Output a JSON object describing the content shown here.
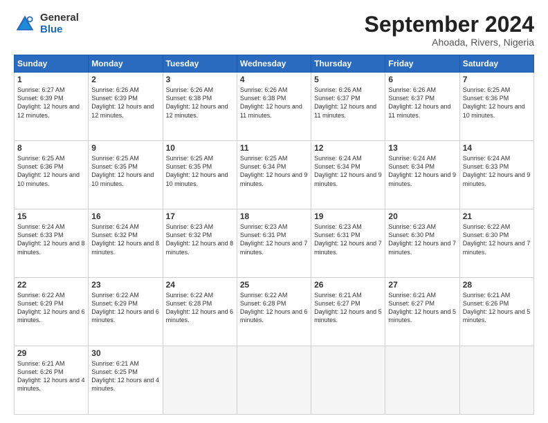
{
  "logo": {
    "general": "General",
    "blue": "Blue"
  },
  "title": "September 2024",
  "location": "Ahoada, Rivers, Nigeria",
  "days_of_week": [
    "Sunday",
    "Monday",
    "Tuesday",
    "Wednesday",
    "Thursday",
    "Friday",
    "Saturday"
  ],
  "weeks": [
    [
      {
        "day": "1",
        "info": "Sunrise: 6:27 AM\nSunset: 6:39 PM\nDaylight: 12 hours\nand 12 minutes."
      },
      {
        "day": "2",
        "info": "Sunrise: 6:26 AM\nSunset: 6:39 PM\nDaylight: 12 hours\nand 12 minutes."
      },
      {
        "day": "3",
        "info": "Sunrise: 6:26 AM\nSunset: 6:38 PM\nDaylight: 12 hours\nand 12 minutes."
      },
      {
        "day": "4",
        "info": "Sunrise: 6:26 AM\nSunset: 6:38 PM\nDaylight: 12 hours\nand 11 minutes."
      },
      {
        "day": "5",
        "info": "Sunrise: 6:26 AM\nSunset: 6:37 PM\nDaylight: 12 hours\nand 11 minutes."
      },
      {
        "day": "6",
        "info": "Sunrise: 6:26 AM\nSunset: 6:37 PM\nDaylight: 12 hours\nand 11 minutes."
      },
      {
        "day": "7",
        "info": "Sunrise: 6:25 AM\nSunset: 6:36 PM\nDaylight: 12 hours\nand 10 minutes."
      }
    ],
    [
      {
        "day": "8",
        "info": "Sunrise: 6:25 AM\nSunset: 6:36 PM\nDaylight: 12 hours\nand 10 minutes."
      },
      {
        "day": "9",
        "info": "Sunrise: 6:25 AM\nSunset: 6:35 PM\nDaylight: 12 hours\nand 10 minutes."
      },
      {
        "day": "10",
        "info": "Sunrise: 6:25 AM\nSunset: 6:35 PM\nDaylight: 12 hours\nand 10 minutes."
      },
      {
        "day": "11",
        "info": "Sunrise: 6:25 AM\nSunset: 6:34 PM\nDaylight: 12 hours\nand 9 minutes."
      },
      {
        "day": "12",
        "info": "Sunrise: 6:24 AM\nSunset: 6:34 PM\nDaylight: 12 hours\nand 9 minutes."
      },
      {
        "day": "13",
        "info": "Sunrise: 6:24 AM\nSunset: 6:34 PM\nDaylight: 12 hours\nand 9 minutes."
      },
      {
        "day": "14",
        "info": "Sunrise: 6:24 AM\nSunset: 6:33 PM\nDaylight: 12 hours\nand 9 minutes."
      }
    ],
    [
      {
        "day": "15",
        "info": "Sunrise: 6:24 AM\nSunset: 6:33 PM\nDaylight: 12 hours\nand 8 minutes."
      },
      {
        "day": "16",
        "info": "Sunrise: 6:24 AM\nSunset: 6:32 PM\nDaylight: 12 hours\nand 8 minutes."
      },
      {
        "day": "17",
        "info": "Sunrise: 6:23 AM\nSunset: 6:32 PM\nDaylight: 12 hours\nand 8 minutes."
      },
      {
        "day": "18",
        "info": "Sunrise: 6:23 AM\nSunset: 6:31 PM\nDaylight: 12 hours\nand 7 minutes."
      },
      {
        "day": "19",
        "info": "Sunrise: 6:23 AM\nSunset: 6:31 PM\nDaylight: 12 hours\nand 7 minutes."
      },
      {
        "day": "20",
        "info": "Sunrise: 6:23 AM\nSunset: 6:30 PM\nDaylight: 12 hours\nand 7 minutes."
      },
      {
        "day": "21",
        "info": "Sunrise: 6:22 AM\nSunset: 6:30 PM\nDaylight: 12 hours\nand 7 minutes."
      }
    ],
    [
      {
        "day": "22",
        "info": "Sunrise: 6:22 AM\nSunset: 6:29 PM\nDaylight: 12 hours\nand 6 minutes."
      },
      {
        "day": "23",
        "info": "Sunrise: 6:22 AM\nSunset: 6:29 PM\nDaylight: 12 hours\nand 6 minutes."
      },
      {
        "day": "24",
        "info": "Sunrise: 6:22 AM\nSunset: 6:28 PM\nDaylight: 12 hours\nand 6 minutes."
      },
      {
        "day": "25",
        "info": "Sunrise: 6:22 AM\nSunset: 6:28 PM\nDaylight: 12 hours\nand 6 minutes."
      },
      {
        "day": "26",
        "info": "Sunrise: 6:21 AM\nSunset: 6:27 PM\nDaylight: 12 hours\nand 5 minutes."
      },
      {
        "day": "27",
        "info": "Sunrise: 6:21 AM\nSunset: 6:27 PM\nDaylight: 12 hours\nand 5 minutes."
      },
      {
        "day": "28",
        "info": "Sunrise: 6:21 AM\nSunset: 6:26 PM\nDaylight: 12 hours\nand 5 minutes."
      }
    ],
    [
      {
        "day": "29",
        "info": "Sunrise: 6:21 AM\nSunset: 6:26 PM\nDaylight: 12 hours\nand 4 minutes."
      },
      {
        "day": "30",
        "info": "Sunrise: 6:21 AM\nSunset: 6:25 PM\nDaylight: 12 hours\nand 4 minutes."
      },
      {
        "day": "",
        "info": ""
      },
      {
        "day": "",
        "info": ""
      },
      {
        "day": "",
        "info": ""
      },
      {
        "day": "",
        "info": ""
      },
      {
        "day": "",
        "info": ""
      }
    ]
  ]
}
